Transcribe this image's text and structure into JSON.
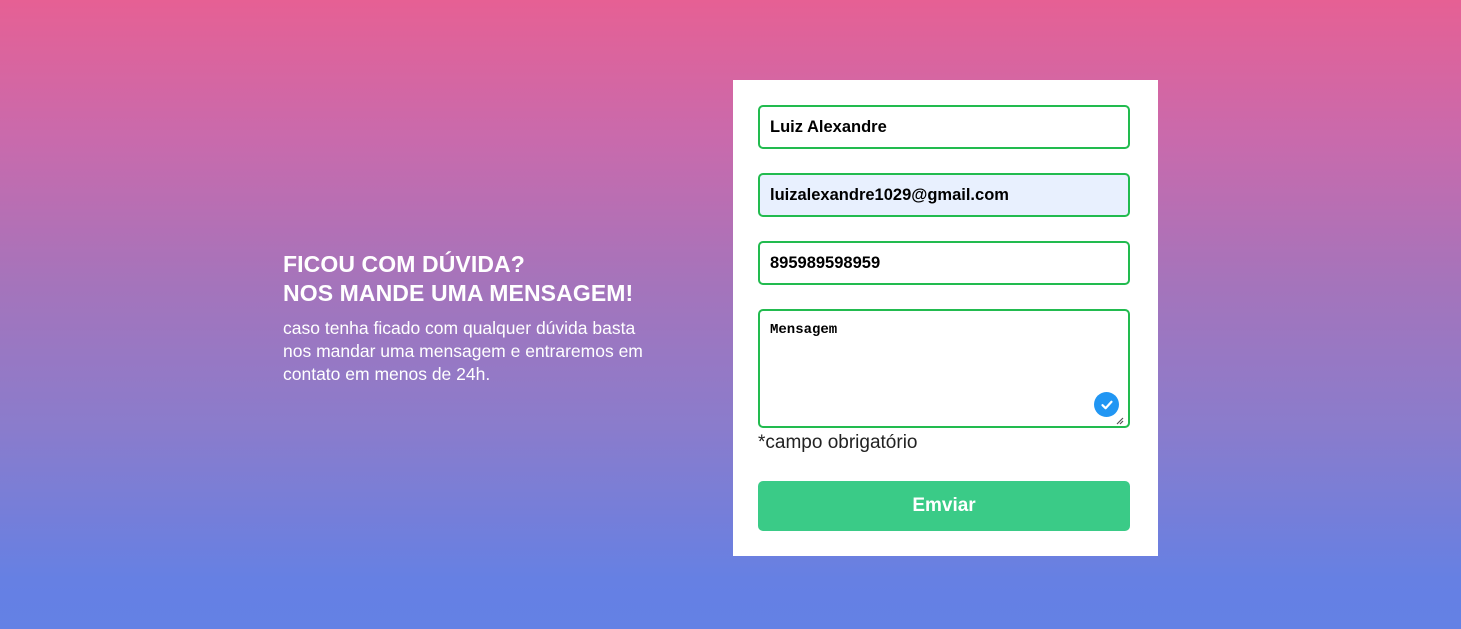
{
  "intro": {
    "title_line1": "FICOU COM DÚVIDA?",
    "title_line2": "NOS MANDE UMA MENSAGEM!",
    "text": "caso tenha ficado com qualquer dúvida basta nos mandar uma mensagem e entraremos em contato em menos de 24h."
  },
  "form": {
    "name_value": "Luiz Alexandre",
    "email_value": "luizalexandre1029@gmail.com",
    "phone_value": "895989598959",
    "message_placeholder": "Mensagem",
    "required_note": "*campo obrigatório",
    "submit_label": "Emviar",
    "check_icon": "check-circle-icon"
  },
  "colors": {
    "gradient_top": "#e66094",
    "gradient_bottom": "#6381e5",
    "field_border": "#22bb4f",
    "autofill_bg": "#e8f0fe",
    "button_bg": "#3acb87",
    "badge_bg": "#2196f3"
  }
}
